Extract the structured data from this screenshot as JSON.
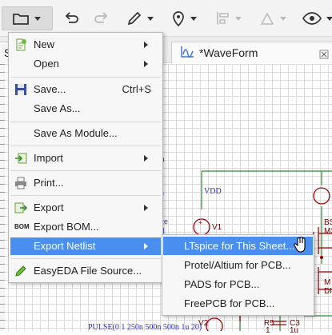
{
  "tabs": {
    "left_tab": "Sta",
    "waveform_tab": "*WaveForm"
  },
  "file_menu": {
    "items": [
      {
        "label": "New"
      },
      {
        "label": "Open"
      },
      {
        "label": "Save...",
        "shortcut": "Ctrl+S"
      },
      {
        "label": "Save As..."
      },
      {
        "label": "Save As Module..."
      },
      {
        "label": "Import"
      },
      {
        "label": "Print..."
      },
      {
        "label": "Export"
      },
      {
        "label": "Export BOM..."
      },
      {
        "label": "Export Netlist"
      },
      {
        "label": "EasyEDA File Source..."
      }
    ],
    "bom_icon_text": "BOM"
  },
  "netlist_submenu": {
    "items": [
      {
        "label": "LTspice for This Sheet..."
      },
      {
        "label": "Protel/Altium for PCB..."
      },
      {
        "label": "PADS for PCB..."
      },
      {
        "label": "FreePCB for PCB..."
      }
    ]
  },
  "schematic": {
    "labels": {
      "n": "n",
      "vdd": "VDD",
      "v1": "V1",
      "v2": "V2",
      "r5": "R5",
      "c3": "C3",
      "one_k": "1",
      "one_u": "1u",
      "bs": "BS",
      "m2": "M2",
      "m": "M",
      "di": "DI",
      "ce": "ce",
      "d": "d",
      "pulse": "PULSE(0 1 250n 500n 500n 1u 20)"
    }
  },
  "colors": {
    "accent": "#4a8ff0",
    "wire": "#2e8b2e",
    "component": "#a00000",
    "label_blue": "#2a2ad0"
  }
}
